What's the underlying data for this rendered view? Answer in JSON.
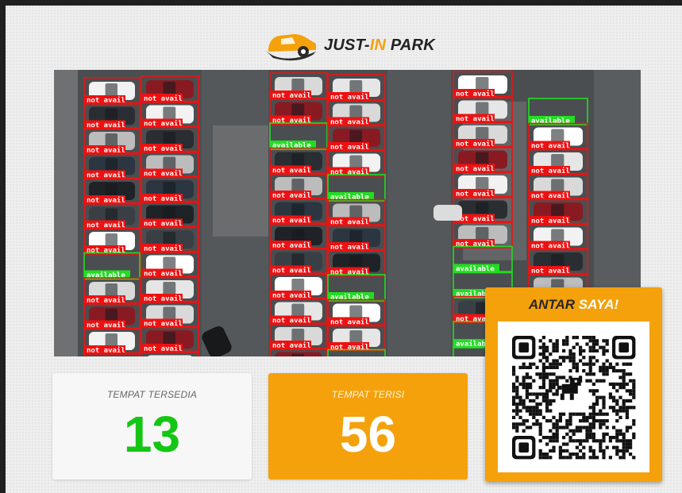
{
  "brand": {
    "name_part1": "JUST-",
    "name_part2": "IN",
    "name_part3": " PARK",
    "colors": {
      "accent": "#f4a10c",
      "dark": "#262626",
      "available": "#14c614"
    },
    "icon": "car-logo-icon"
  },
  "camera": {
    "label_occupied": "not avail",
    "label_available": "available",
    "icon": "parking-lot-camera-feed"
  },
  "stats": {
    "available_title": "TEMPAT TERSEDIA",
    "available_value": "13",
    "occupied_title": "TEMPAT TERISI",
    "occupied_value": "56"
  },
  "qr": {
    "title_part1": "ANTAR ",
    "title_part2": "SAYA!",
    "icon": "qr-code-icon",
    "center_icon": "dino-icon"
  }
}
